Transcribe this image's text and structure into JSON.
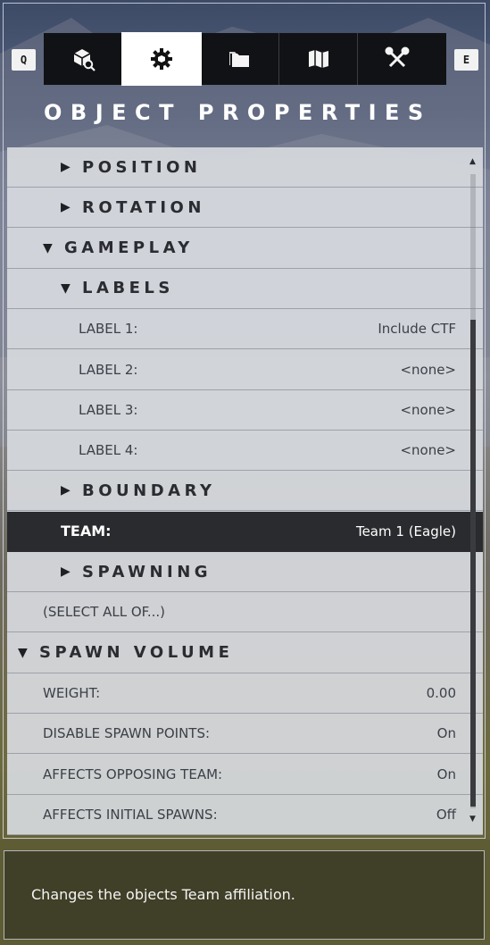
{
  "hotkeys": {
    "left": "Q",
    "right": "E"
  },
  "toolbar": {
    "tabs": [
      {
        "icon": "object-browser-icon",
        "active": false
      },
      {
        "icon": "object-properties-gear-icon",
        "active": true
      },
      {
        "icon": "folders-icon",
        "active": false
      },
      {
        "icon": "map-icon",
        "active": false
      },
      {
        "icon": "tools-icon",
        "active": false
      }
    ]
  },
  "panel": {
    "title": "OBJECT PROPERTIES",
    "rows": [
      {
        "type": "section",
        "label": "POSITION",
        "expanded": false
      },
      {
        "type": "section",
        "label": "ROTATION",
        "expanded": false
      },
      {
        "type": "section",
        "label": "GAMEPLAY",
        "expanded": true
      },
      {
        "type": "section",
        "label": "LABELS",
        "expanded": true
      },
      {
        "type": "prop",
        "label": "LABEL 1:",
        "value": "Include CTF"
      },
      {
        "type": "prop",
        "label": "LABEL 2:",
        "value": "<none>"
      },
      {
        "type": "prop",
        "label": "LABEL 3:",
        "value": "<none>"
      },
      {
        "type": "prop",
        "label": "LABEL 4:",
        "value": "<none>"
      },
      {
        "type": "section",
        "label": "BOUNDARY",
        "expanded": false
      },
      {
        "type": "prop",
        "label": "TEAM:",
        "value": "Team 1 (Eagle)",
        "selected": true
      },
      {
        "type": "section",
        "label": "SPAWNING",
        "expanded": false
      },
      {
        "type": "prop",
        "label": "(SELECT ALL OF...)",
        "value": ""
      },
      {
        "type": "section",
        "label": "SPAWN VOLUME",
        "expanded": true
      },
      {
        "type": "prop",
        "label": "WEIGHT:",
        "value": "0.00"
      },
      {
        "type": "prop",
        "label": "DISABLE SPAWN POINTS:",
        "value": "On"
      },
      {
        "type": "prop",
        "label": "AFFECTS OPPOSING TEAM:",
        "value": "On"
      },
      {
        "type": "prop",
        "label": "AFFECTS INITIAL SPAWNS:",
        "value": "Off"
      }
    ]
  },
  "tooltip": {
    "text": "Changes the objects Team affiliation."
  },
  "colors": {
    "selected_row": "#2a2b2e",
    "panel_bg": "#d6d9de",
    "accent_active_tab": "#ffffff"
  }
}
